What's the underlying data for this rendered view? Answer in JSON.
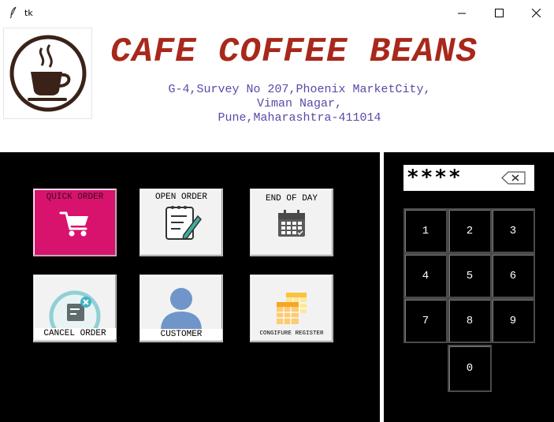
{
  "window": {
    "title": "tk"
  },
  "header": {
    "brand": "CAFE COFFEE BEANS",
    "address_lines": [
      "G-4,Survey No 207,Phoenix MarketCity,",
      "Viman Nagar,",
      "Pune,Maharashtra-411014"
    ]
  },
  "tiles": {
    "quick_order": "QUICK ORDER",
    "open_order": "OPEN ORDER",
    "end_of_day": "END OF DAY",
    "cancel_order": "CANCEL ORDER",
    "customer": "CUSTOMER",
    "configure_register": "CONGIFURE REGISTER"
  },
  "pin": {
    "value": "****"
  },
  "keypad": {
    "keys": [
      "1",
      "2",
      "3",
      "4",
      "5",
      "6",
      "7",
      "8",
      "9",
      "0"
    ]
  },
  "colors": {
    "brand": "#a8281b",
    "address": "#5b48a8",
    "quick_order_bg": "#d8136e",
    "panel_bg": "#000000"
  },
  "icons": {
    "app": "feather-icon",
    "logo": "coffee-cup-icon",
    "quick_order": "shopping-cart-icon",
    "open_order": "notepad-pencil-icon",
    "end_of_day": "calendar-icon",
    "cancel_order": "cancel-document-icon",
    "customer": "user-silhouette-icon",
    "configure_register": "spreadsheet-icon",
    "pin_clear": "backspace-icon"
  }
}
